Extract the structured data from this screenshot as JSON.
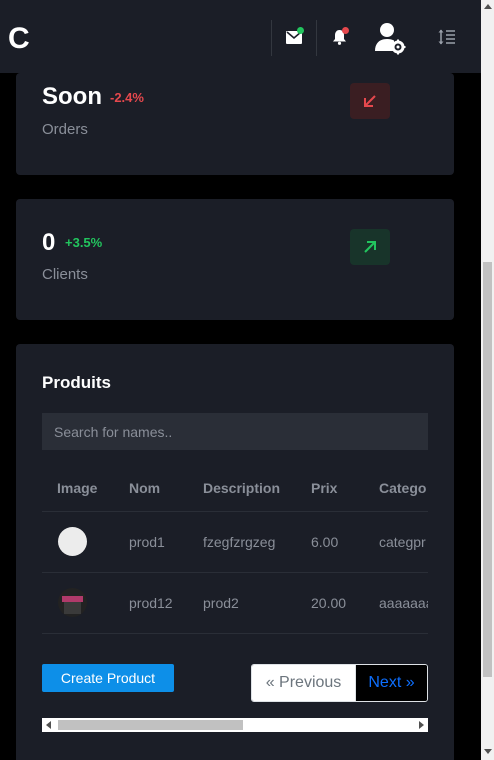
{
  "header": {
    "brand": "C"
  },
  "stats": [
    {
      "value": "Soon",
      "change": "-2.4%",
      "label": "Orders",
      "trend": "down",
      "trend_color": "#e5484d"
    },
    {
      "value": "0",
      "change": "+3.5%",
      "label": "Clients",
      "trend": "up",
      "trend_color": "#22c55e"
    }
  ],
  "products": {
    "title": "Produits",
    "search_placeholder": "Search for names..",
    "columns": [
      "Image",
      "Nom",
      "Description",
      "Prix",
      "Catego"
    ],
    "rows": [
      {
        "nom": "prod1",
        "description": "fzegfzrgzeg",
        "prix": "6.00",
        "categorie": "categpr"
      },
      {
        "nom": "prod12",
        "description": "prod2",
        "prix": "20.00",
        "categorie": "aaaaaaa"
      }
    ],
    "create_label": "Create Product",
    "previous_label": "« Previous",
    "next_label": "Next »"
  },
  "colors": {
    "background": "#000000",
    "card": "#1b1e27",
    "accent": "#0d8fe8",
    "mail_dot": "#22c55e",
    "bell_dot": "#e5484d"
  }
}
